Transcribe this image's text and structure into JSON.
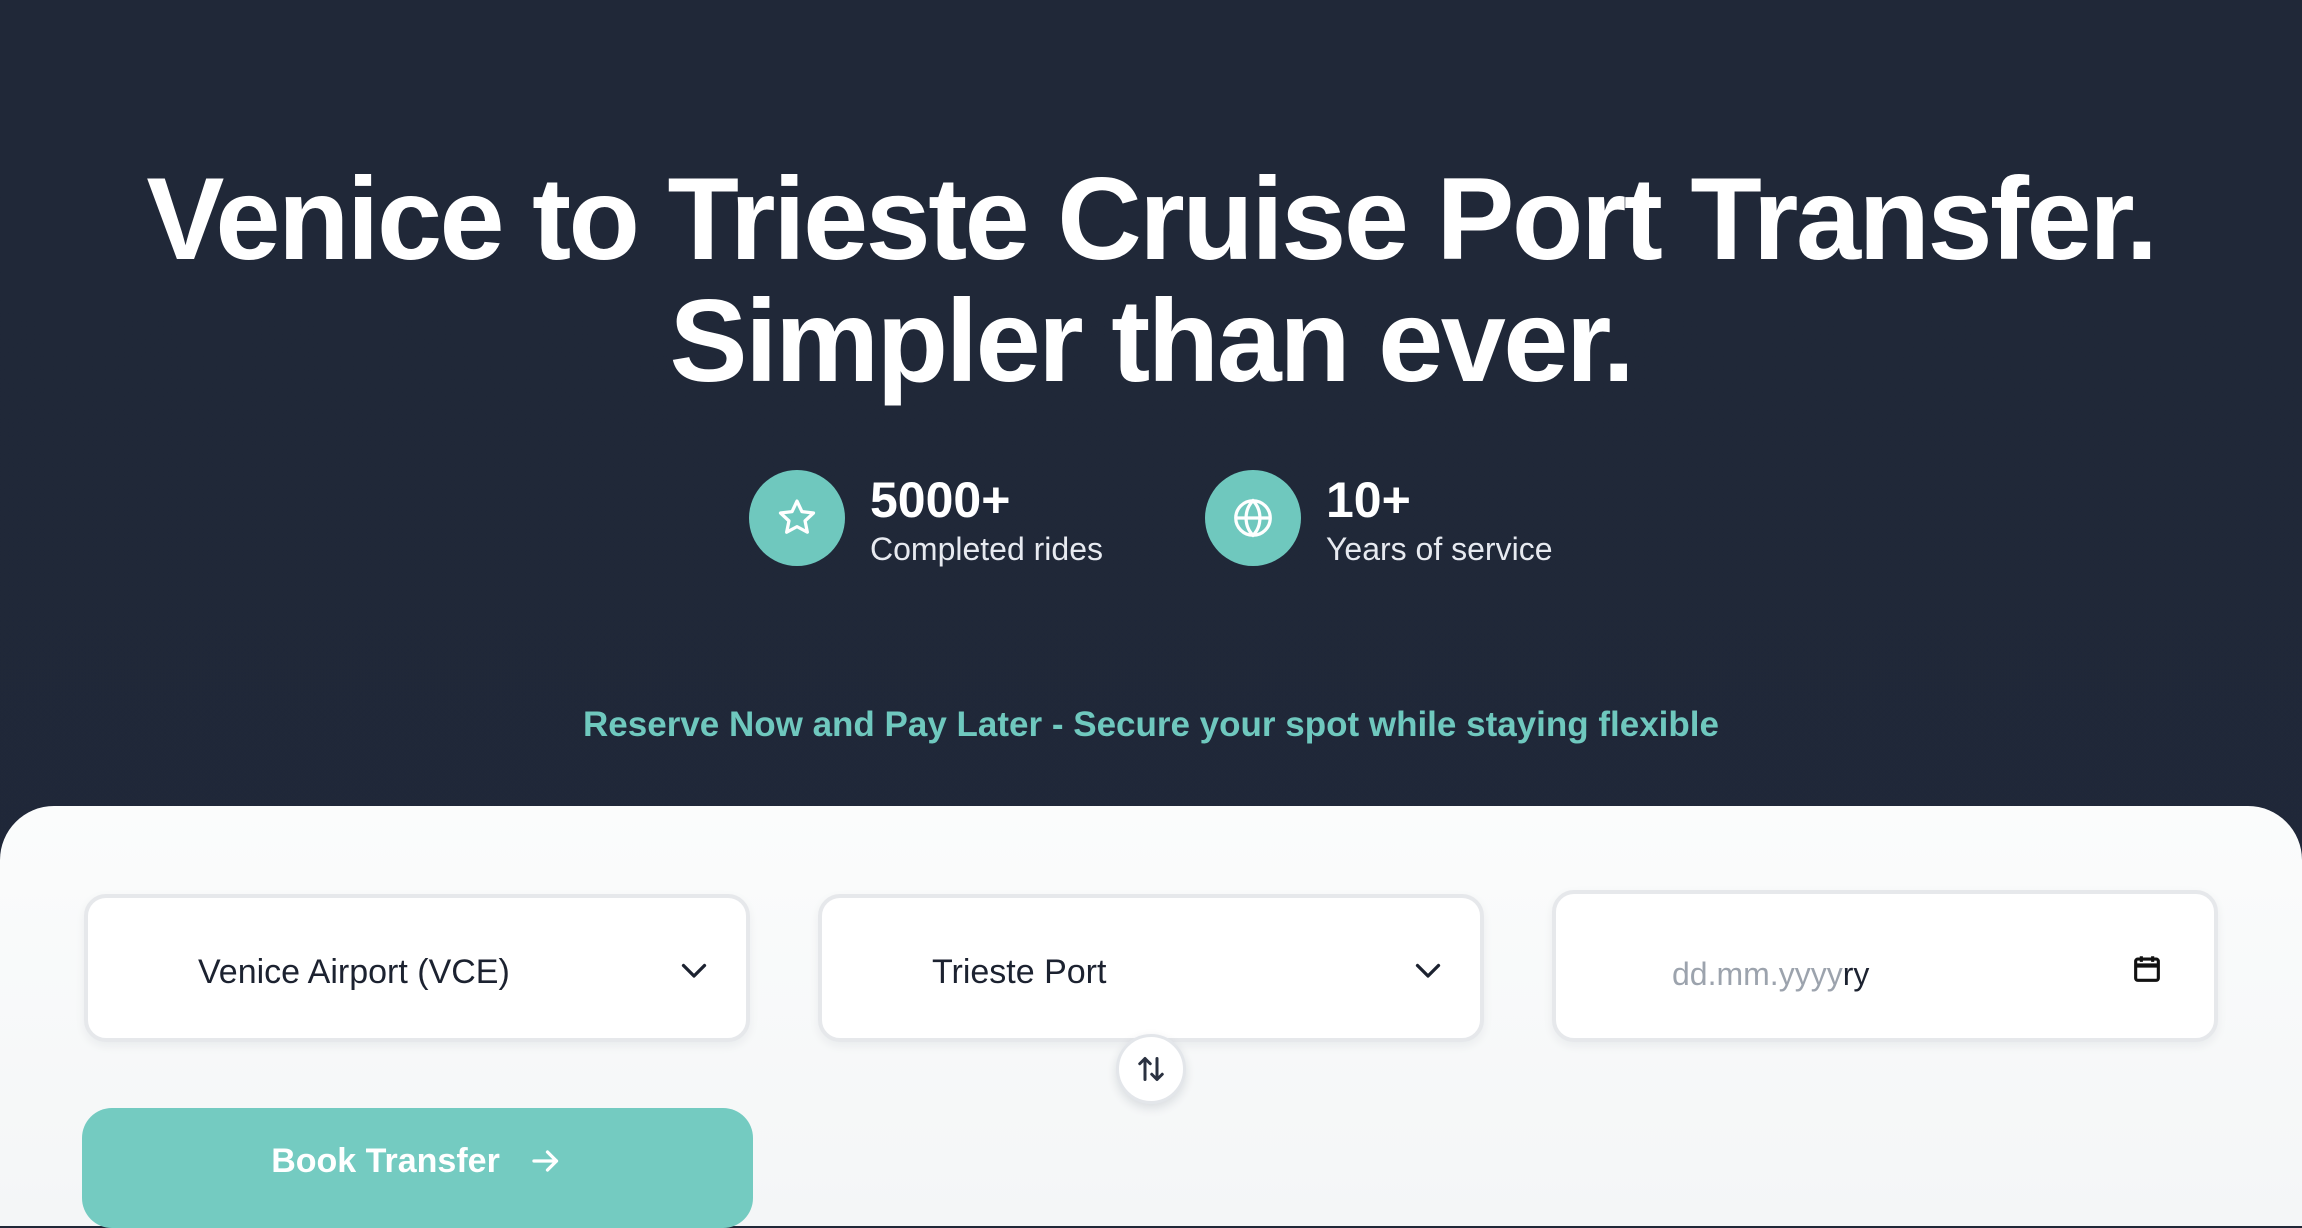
{
  "hero": {
    "title_line1": "Venice to Trieste Cruise Port Transfer.",
    "title_line2": "Simpler than ever.",
    "stats": [
      {
        "value": "5000+",
        "label": "Completed rides",
        "icon": "star-icon"
      },
      {
        "value": "10+",
        "label": "Years of service",
        "icon": "globe-icon"
      }
    ],
    "promo": "Reserve Now and Pay Later - Secure your spot while staying flexible"
  },
  "booking": {
    "from": {
      "value": "Venice Airport (VCE)",
      "icon": "chevron-down-icon"
    },
    "to": {
      "value": "Trieste Port",
      "icon": "chevron-down-icon"
    },
    "date": {
      "placeholder": "dd.mm.yyyy",
      "overflow_text": "ry",
      "icon": "calendar-icon"
    },
    "swap_icon": "swap-vertical-icon",
    "submit_label": "Book Transfer",
    "submit_icon": "arrow-right-icon"
  },
  "colors": {
    "background": "#202838",
    "accent": "#6fc8be",
    "button": "#74cbc1",
    "panel": "#fbfcfc",
    "text_dark": "#1c2230",
    "placeholder": "#9ca3ad"
  }
}
